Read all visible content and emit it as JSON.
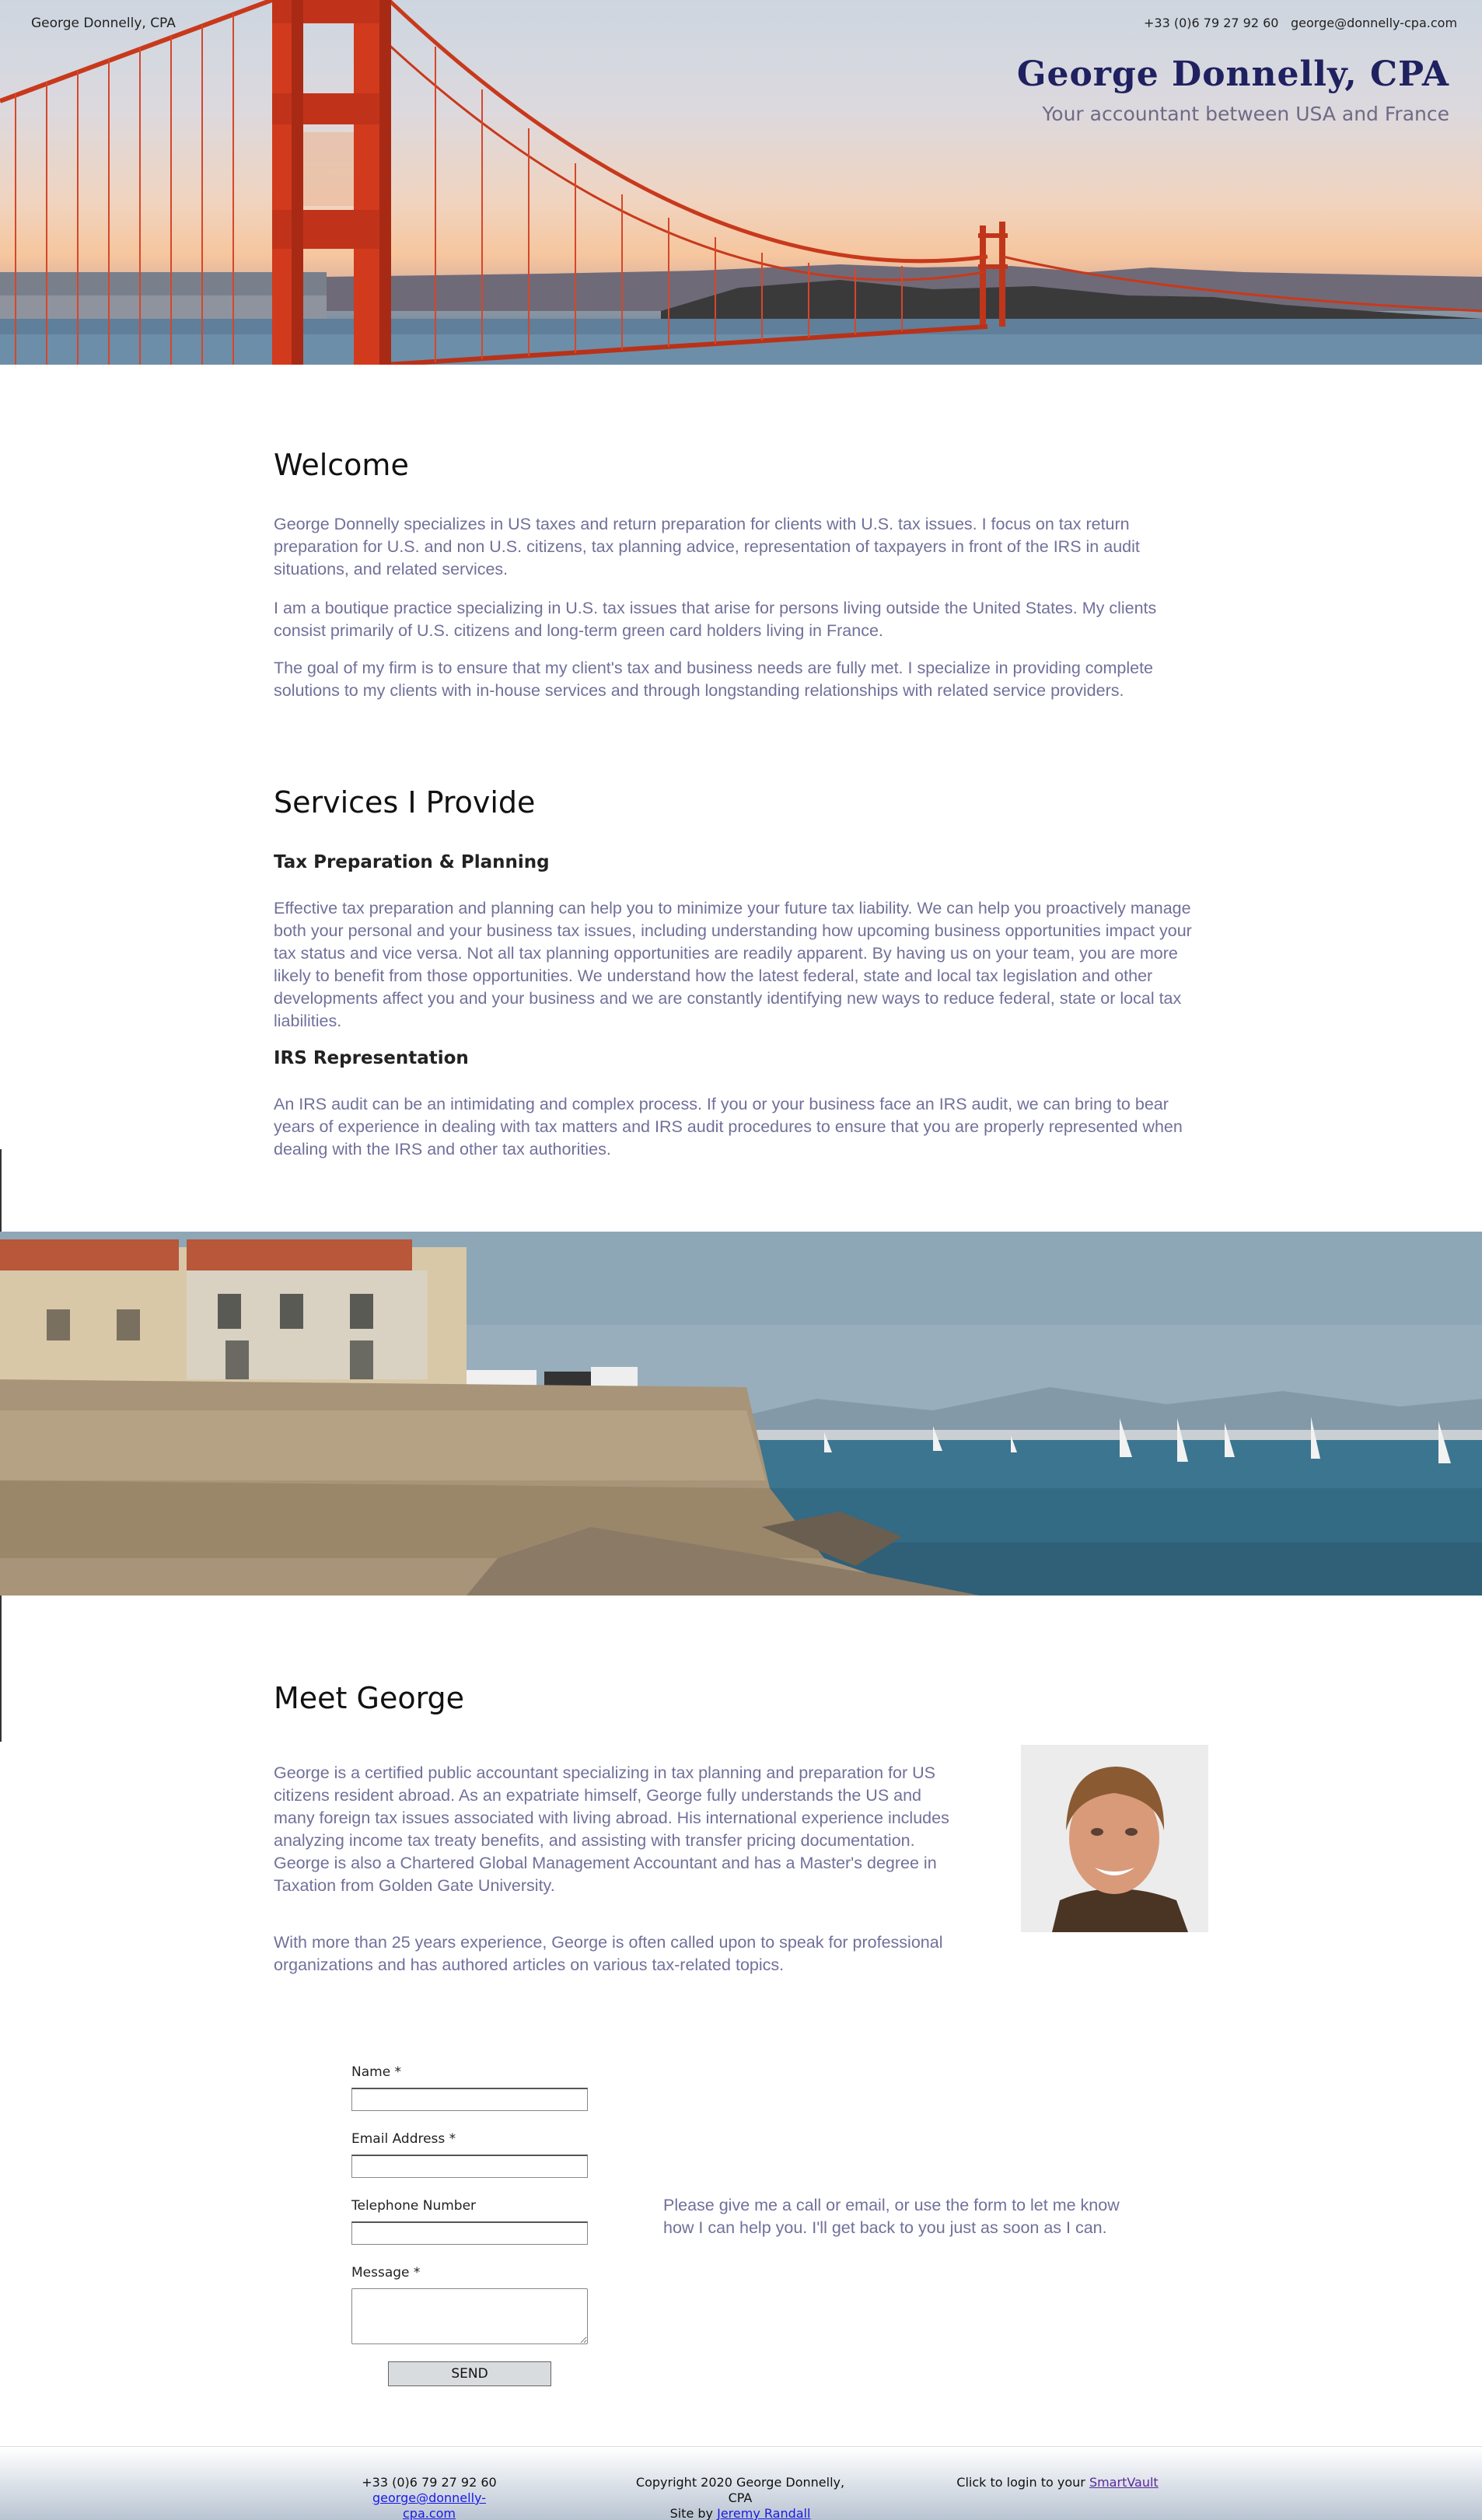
{
  "header": {
    "site_name": "George Donnelly, CPA",
    "phone": "+33 (0)6 79 27 92 60",
    "email": "george@donnelly-cpa.com",
    "title": "George Donnelly, CPA",
    "tagline": "Your accountant between USA and France"
  },
  "welcome": {
    "heading": "Welcome",
    "paragraphs": [
      "George Donnelly specializes in US taxes and return preparation for clients with U.S. tax issues.  I focus on tax return preparation for U.S. and non U.S. citizens, tax planning advice, representation of taxpayers in front of the IRS in audit situations, and related services.",
      "I am a boutique practice specializing in U.S. tax issues that arise for persons living outside the United States.  My clients consist primarily of U.S. citizens and long-term green card holders living in France.",
      "The goal of my firm is to ensure that my client's tax and business needs are fully met. I specialize in providing complete solutions to my clients with in-house services and through longstanding relationships with related service providers."
    ]
  },
  "services": {
    "heading": "Services I Provide",
    "items": [
      {
        "title": "Tax Preparation & Planning",
        "text": "Effective tax preparation and planning can help you to minimize your future tax liability. We can help you proactively manage both your personal and your business tax issues, including understanding how upcoming business opportunities impact your tax status and vice versa. Not all tax planning opportunities are readily apparent. By having us on your team, you are more likely to benefit from those opportunities. We understand how the latest federal, state and local tax legislation and other developments affect you and your business and we are constantly identifying new ways to reduce federal, state or local tax liabilities."
      },
      {
        "title": "IRS Representation",
        "text": "An IRS audit can be an intimidating and complex process. If you or your business face an IRS audit, we can bring to bear years of experience in dealing with tax matters and IRS audit procedures to ensure that you are properly represented when dealing with the IRS and other tax authorities."
      }
    ]
  },
  "meet": {
    "heading": "Meet George",
    "paragraphs": [
      "George is a certified public accountant specializing in tax planning and preparation for US citizens resident abroad. As an expatriate himself, George fully understands the US and many foreign tax issues associated with living abroad. His international experience includes analyzing income tax treaty benefits, and assisting with transfer pricing documentation. George is also a Chartered Global Management Accountant and has a Master's degree in Taxation from Golden Gate University.",
      "With more than 25 years experience, George is often called upon to speak for professional organizations and has authored articles on various tax-related topics."
    ]
  },
  "contact_form": {
    "name_label": "Name *",
    "name_value": "",
    "email_label": "Email Address *",
    "email_value": "",
    "phone_label": "Telephone Number",
    "phone_value": "",
    "message_label": "Message *",
    "message_value": "",
    "send_label": "SEND",
    "side_text": "Please give me a call or email, or use the form to let me know how I can help you. I'll get back to you just as soon as I can."
  },
  "footer": {
    "phone": "+33 (0)6 79 27 92 60",
    "email": "george@donnelly-cpa.com",
    "copyright": "Copyright 2020 George Donnelly, CPA",
    "site_by_prefix": "Site by",
    "site_by_name": "Jeremy Randall",
    "login_prefix": "Click to login to your",
    "login_link": "SmartVault"
  },
  "colors": {
    "title": "#1f2160",
    "body_text": "#71709a",
    "link": "#1a1ae6",
    "bridge": "#d13a1c"
  }
}
